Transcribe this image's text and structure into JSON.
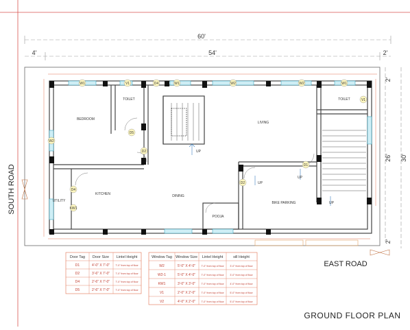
{
  "title": "GROUND FLOOR PLAN",
  "roads": {
    "south": "SOUTH ROAD",
    "east": "EAST ROAD"
  },
  "dimensions": {
    "overall_width": "60'",
    "left_offset": "4'",
    "inner_width": "54'",
    "right_offset": "2'",
    "top_right_offset": "2'",
    "inner_depth": "26'",
    "overall_depth": "30'",
    "bottom_right_offset": "2'"
  },
  "rooms": {
    "bedroom": "BEDROOM",
    "toilet_1": "TOILET",
    "living": "LIVING",
    "toilet_2": "TOILET",
    "kitchen": "KITCHEN",
    "utility": "UTILITY",
    "dining": "DINING",
    "pooja": "POOJA",
    "bike_parking": "BIKE PARKING"
  },
  "stairs": {
    "up_1": "UP",
    "up_2": "UP",
    "up_3": "UP",
    "up_4": "UP"
  },
  "door_schedule": {
    "headers": [
      "Door Tag",
      "Door Size",
      "Lintel Height"
    ],
    "rows": [
      [
        "D1",
        "4'-0\" X 7'-0\"",
        "7'-0\" from top of floor"
      ],
      [
        "D2",
        "3'-6\" X 7'-0\"",
        "7'-0\" from top of floor"
      ],
      [
        "D4",
        "2'-6\" X 7'-0\"",
        "7'-0\" from top of floor"
      ],
      [
        "D5",
        "2'-6\" X 7'-0\"",
        "7'-0\" from top of floor"
      ]
    ]
  },
  "window_schedule": {
    "headers": [
      "Window Tag",
      "Window Size",
      "Lintel Height",
      "sill Height"
    ],
    "rows": [
      [
        "W2",
        "5'-0\" X 4'-0\"",
        "7'-0\" from top of floor",
        "3'-0\" from top of floor"
      ],
      [
        "W2-1",
        "5'-0\" X 4'-0\"",
        "7'-0\" from top of floor",
        "3'-0\" from top of floor"
      ],
      [
        "KW1",
        "3'-0\" X 3'-0\"",
        "7'-0\" from top of floor",
        "4'-0\" from top of floor"
      ],
      [
        "V1",
        "2'-0\" X 2'-0\"",
        "7'-0\" from top of floor",
        "5'-0\" from top of floor"
      ],
      [
        "V2",
        "4'-0\" X 2'-0\"",
        "7'-0\" from top of floor",
        "5'-0\" from top of floor"
      ]
    ]
  },
  "tags": {
    "w1": "W1",
    "w2": "W2",
    "v1": "V1",
    "d1": "D1",
    "d2": "D2",
    "d4": "D4",
    "d5": "D5",
    "kw1": "KW1"
  }
}
